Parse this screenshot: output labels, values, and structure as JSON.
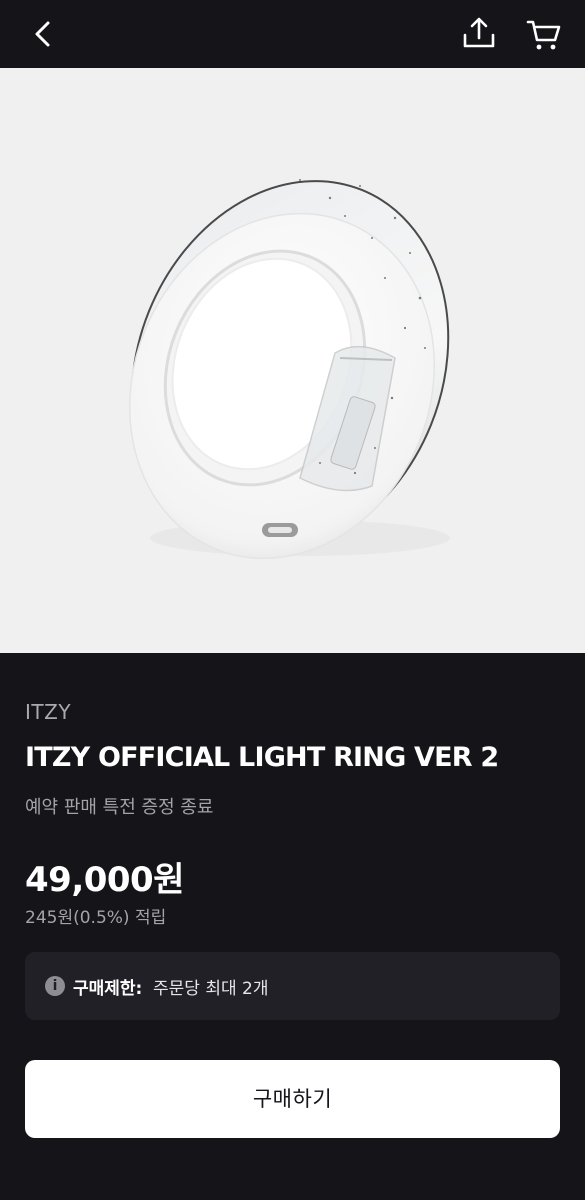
{
  "header": {
    "back_icon": "chevron-left-icon",
    "share_icon": "share-upload-icon",
    "cart_icon": "shopping-cart-icon"
  },
  "product": {
    "image": "light-ring-product-photo",
    "brand": "ITZY",
    "name": "ITZY OFFICIAL LIGHT RING VER 2",
    "notice": "예약 판매 특전 증정 종료",
    "price": "49,000원",
    "points": "245원(0.5%) 적립",
    "purchase_limit": {
      "icon": "info-icon",
      "icon_glyph": "i",
      "label": "구매제한:",
      "value": "주문당 최대 2개"
    }
  },
  "actions": {
    "buy_label": "구매하기"
  },
  "colors": {
    "background": "#141419",
    "image_background": "#f0f0f0",
    "button_background": "#ffffff",
    "limit_box": "#202026",
    "muted_text": "#a3a3a8"
  }
}
